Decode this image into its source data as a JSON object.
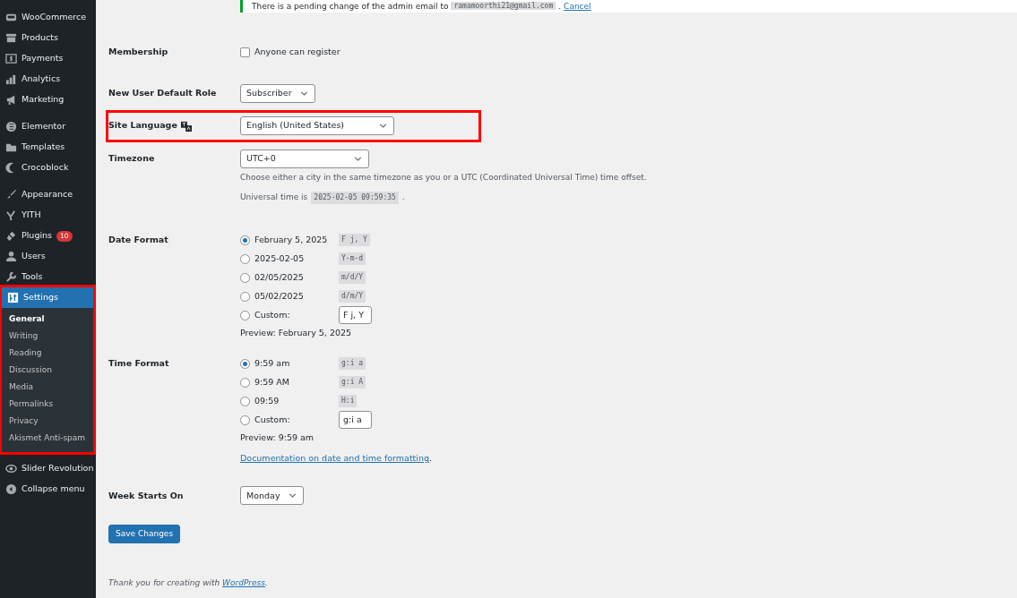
{
  "sidebar": {
    "groups": [
      [
        {
          "label": "WooCommerce",
          "selected": false
        },
        {
          "label": "Products",
          "selected": false
        },
        {
          "label": "Payments",
          "selected": false
        },
        {
          "label": "Analytics",
          "selected": false
        },
        {
          "label": "Marketing",
          "selected": false
        }
      ],
      [
        {
          "label": "Elementor",
          "selected": false
        },
        {
          "label": "Templates",
          "selected": false
        },
        {
          "label": "Crocoblock",
          "selected": false
        }
      ],
      [
        {
          "label": "Appearance",
          "selected": false
        },
        {
          "label": "YITH",
          "selected": false
        },
        {
          "label": "Plugins",
          "badge": "10",
          "selected": false
        },
        {
          "label": "Users",
          "selected": false
        },
        {
          "label": "Tools",
          "selected": false
        },
        {
          "label": "Settings",
          "selected": true,
          "highlighted": true,
          "children": [
            {
              "label": "General",
              "selected": true
            },
            {
              "label": "Writing",
              "selected": false
            },
            {
              "label": "Reading",
              "selected": false
            },
            {
              "label": "Discussion",
              "selected": false
            },
            {
              "label": "Media",
              "selected": false
            },
            {
              "label": "Permalinks",
              "selected": false
            },
            {
              "label": "Privacy",
              "selected": false
            },
            {
              "label": "Akismet Anti-spam",
              "selected": false
            }
          ]
        }
      ],
      [
        {
          "label": "Slider Revolution",
          "selected": false
        },
        {
          "label": "Collapse menu",
          "selected": false
        }
      ]
    ]
  },
  "notice": {
    "text": "There is a pending change of the admin email to",
    "email": "ramamoorthi21@gmail.com",
    "after": ".",
    "link": "Cancel"
  },
  "fields": [
    {
      "kind": "checkbox",
      "label": "Membership",
      "option": "Anyone can register",
      "checked": false
    },
    {
      "kind": "select",
      "label": "New User Default Role",
      "value": "Subscriber"
    },
    {
      "kind": "language",
      "label": "Site Language",
      "value": "English (United States)",
      "highlighted": true
    },
    {
      "kind": "select",
      "label": "Timezone",
      "value": "UTC+0",
      "description": "Choose either a city in the same timezone as you or a UTC (Coordinated Universal Time) time offset.",
      "time_label": "Universal time is",
      "time": "2025-02-05 09:59:35",
      "time_after": "."
    },
    {
      "kind": "radios",
      "label": "Date Format",
      "options": [
        {
          "text": "February 5, 2025",
          "code": "F j, Y",
          "selected": true
        },
        {
          "text": "2025-02-05",
          "code": "Y-m-d",
          "selected": false
        },
        {
          "text": "02/05/2025",
          "code": "m/d/Y",
          "selected": false
        },
        {
          "text": "05/02/2025",
          "code": "d/m/Y",
          "selected": false
        },
        {
          "text": "Custom:",
          "custom_value": "F j, Y",
          "selected": false
        }
      ],
      "preview": "Preview: February 5, 2025"
    },
    {
      "kind": "radios",
      "label": "Time Format",
      "options": [
        {
          "text": "9:59 am",
          "code": "g:i a",
          "selected": true
        },
        {
          "text": "9:59 AM",
          "code": "g:i A",
          "selected": false
        },
        {
          "text": "09:59",
          "code": "H:i",
          "selected": false
        },
        {
          "text": "Custom:",
          "custom_value": "g:i a",
          "selected": false
        }
      ],
      "preview": "Preview: 9:59 am",
      "link": "Documentation on date and time formatting",
      "link_after": "."
    },
    {
      "kind": "select",
      "label": "Week Starts On",
      "value": "Monday"
    }
  ],
  "save_button": "Save Changes",
  "footer": {
    "text": "Thank you for creating with",
    "link": "WordPress",
    "after": "."
  }
}
